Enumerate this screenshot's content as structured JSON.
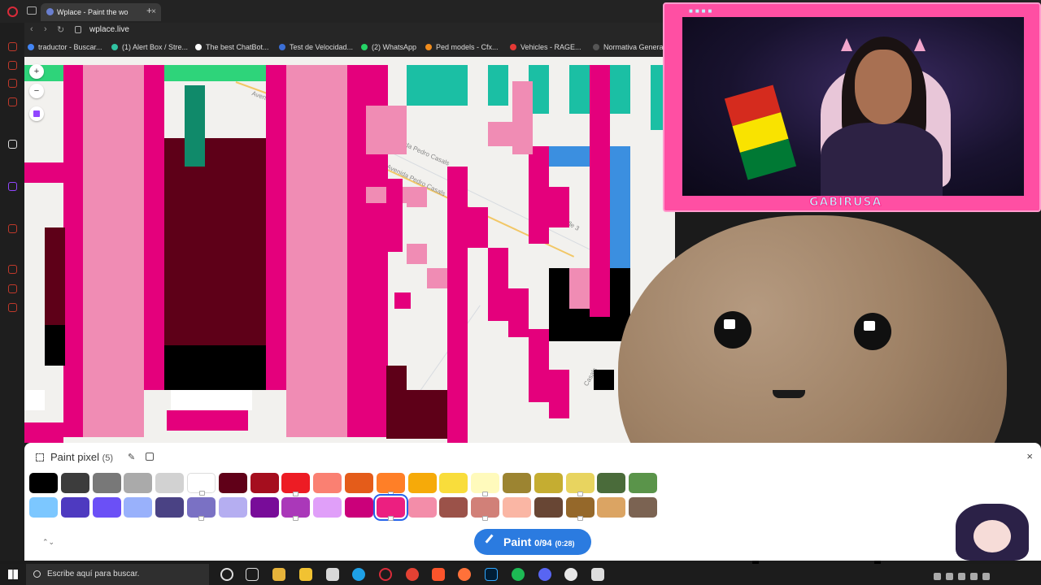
{
  "browser": {
    "tab_title": "Wplace - Paint the wo",
    "url": "wplace.live",
    "bookmarks": [
      {
        "label": "traductor - Buscar...",
        "color": "#4285f4"
      },
      {
        "label": "(1) Alert Box / Stre...",
        "color": "#31c3a2"
      },
      {
        "label": "The best ChatBot...",
        "color": "#ffffff"
      },
      {
        "label": "Test de Velocidad...",
        "color": "#3b6fd6"
      },
      {
        "label": "(2) WhatsApp",
        "color": "#25d366"
      },
      {
        "label": "Ped models - Cfx...",
        "color": "#f08c1d"
      },
      {
        "label": "Vehicles - RAGE...",
        "color": "#e53935"
      },
      {
        "label": "Normativa Genera...",
        "color": "#555555"
      }
    ]
  },
  "map": {
    "street_labels": [
      "Avenida Pedro Casals",
      "Avenida Pedro Casals",
      "Avenida Pedro Casals",
      "Calle 3",
      "Casals"
    ]
  },
  "stream": {
    "streamer_name": "GABIRUSA"
  },
  "palette_panel": {
    "title": "Paint pixel",
    "count": "(5)",
    "paint_label": "Paint",
    "charges": "0/94",
    "timer": "(0:28)",
    "colors_row1": [
      "#000000",
      "#3c3c3c",
      "#787878",
      "#aaaaaa",
      "#d2d2d2",
      "#ffffff",
      "#600018",
      "#a50e1e",
      "#ed1c24",
      "#fa8072",
      "#e45c1a",
      "#ff7f27",
      "#f6aa09",
      "#f9dd3b",
      "#fffabc",
      "#9c8431",
      "#c5ad31",
      "#e8d45f",
      "#4a6b3a",
      "#5a944a"
    ],
    "colors_row2": [
      "#7cc7ff",
      "#4e3ac0",
      "#6b50f6",
      "#99b1fb",
      "#4a4284",
      "#7a71c4",
      "#b5aef1",
      "#780c99",
      "#aa38b9",
      "#e09ff9",
      "#cb007a",
      "#ec1f80",
      "#f38da9",
      "#9b5249",
      "#d18078",
      "#fab6a4",
      "#684634",
      "#95682a",
      "#dba463",
      "#7b6352"
    ],
    "selected_color": "#ec1f80"
  },
  "taskbar": {
    "search_placeholder": "Escribe aquí para buscar."
  }
}
